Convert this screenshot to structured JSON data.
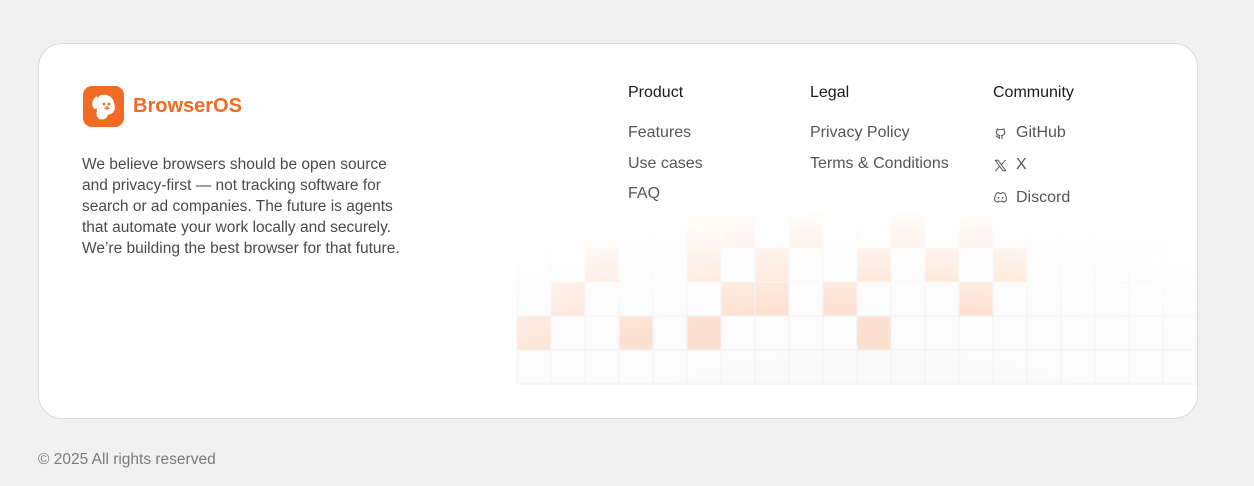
{
  "brand": {
    "name": "BrowserOS",
    "logo_icon": "dog-head-logo-icon",
    "accent_color": "#f26b24",
    "tagline": "We believe browsers should be open source and privacy-first — not tracking software for search or ad companies. The future is agents that automate your work locally and securely. We’re building the best browser for that future."
  },
  "columns": {
    "product": {
      "title": "Product",
      "links": [
        "Features",
        "Use cases",
        "FAQ"
      ]
    },
    "legal": {
      "title": "Legal",
      "links": [
        "Privacy Policy",
        "Terms & Conditions"
      ]
    },
    "community": {
      "title": "Community",
      "links": [
        {
          "label": "GitHub",
          "icon": "github-icon"
        },
        {
          "label": "X",
          "icon": "x-logo-icon"
        },
        {
          "label": "Discord",
          "icon": "discord-icon"
        }
      ]
    }
  },
  "footer": {
    "copyright": "© 2025 All rights reserved"
  }
}
